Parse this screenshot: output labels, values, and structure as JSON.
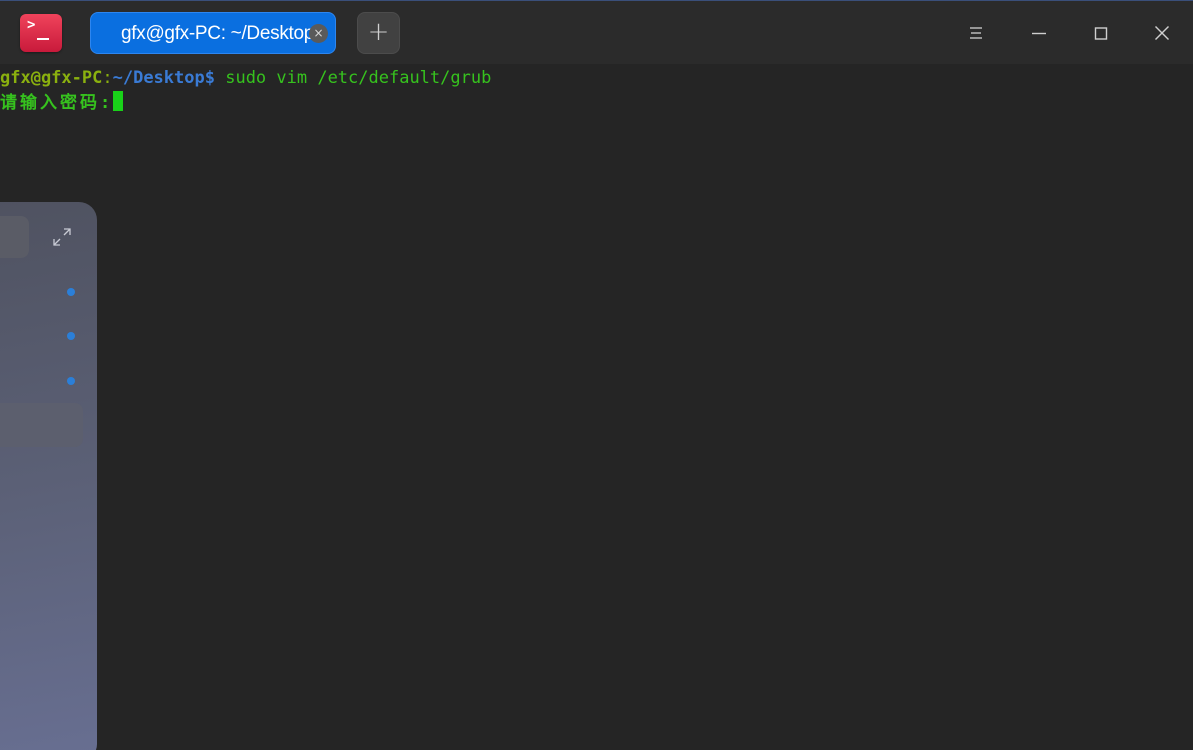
{
  "titlebar": {
    "app_icon": "terminal-icon",
    "tab_title": "gfx@gfx-PC: ~/Desktop",
    "tab_close_glyph": "×",
    "new_tab_glyph": "+",
    "controls": [
      "menu-icon",
      "minimize-icon",
      "maximize-icon",
      "close-icon"
    ]
  },
  "terminal": {
    "prompt_user": "gfx@gfx-PC",
    "prompt_colon": ":",
    "prompt_path": "~/Desktop",
    "prompt_symbol": "$",
    "command": " sudo vim /etc/default/grub",
    "password_prompt": "请输入密码:"
  },
  "colors": {
    "tab_active": "#0a6fe0",
    "prompt_user": "#8ab00f",
    "prompt_path": "#3a7bd5",
    "command": "#36c21e",
    "cursor": "#19d219",
    "background": "#252525"
  }
}
